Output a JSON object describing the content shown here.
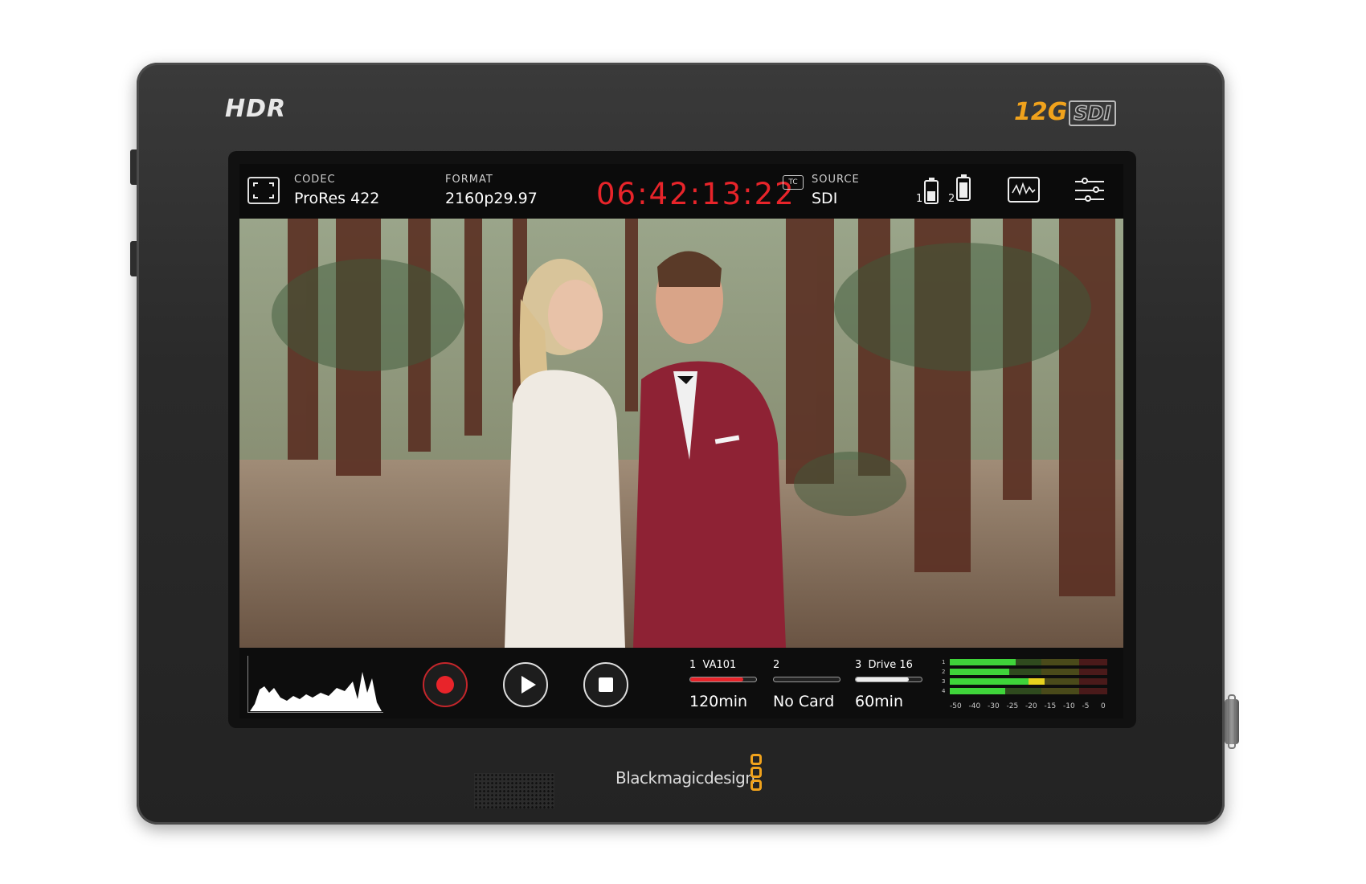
{
  "device": {
    "hdr_badge": "HDR",
    "sdi_badge_prefix": "12G",
    "sdi_badge_suffix": "SDI",
    "brand_name": "Blackmagicdesign"
  },
  "topbar": {
    "codec_label": "CODEC",
    "codec_value": "ProRes 422",
    "format_label": "FORMAT",
    "format_value": "2160p29.97",
    "timecode": "06:42:13:22",
    "tc_badge": "TC",
    "source_label": "SOURCE",
    "source_value": "SDI",
    "battery_1_label": "1",
    "battery_2_label": "2",
    "battery_1_level": 0.55,
    "battery_2_level": 0.85
  },
  "bottombar": {
    "slots": [
      {
        "number": "1",
        "name": "VA101",
        "value": "120min",
        "fill": 0.8,
        "color": "#e8242a"
      },
      {
        "number": "2",
        "name": "",
        "value": "No Card",
        "fill": 0.0,
        "color": "#888888"
      },
      {
        "number": "3",
        "name": "Drive 16",
        "value": "60min",
        "fill": 0.8,
        "color": "#eeeeee"
      }
    ],
    "meter_channels": [
      "1",
      "2",
      "3",
      "4"
    ],
    "meter_scale": [
      "-50",
      "-40",
      "-30",
      "-25",
      "-20",
      "-15",
      "-10",
      "-5",
      "0"
    ],
    "meter_levels": [
      0.42,
      0.38,
      0.6,
      0.35
    ]
  },
  "colors": {
    "timecode": "#e8242a",
    "record": "#e8242a",
    "brand_accent": "#f0a21c"
  },
  "icons": {
    "frame_guides": "frame-guides-icon",
    "scope": "waveform-scope-icon",
    "settings": "settings-sliders-icon"
  }
}
